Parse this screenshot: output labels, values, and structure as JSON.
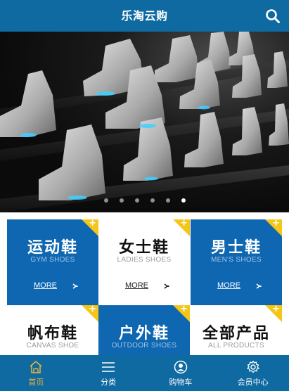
{
  "header": {
    "title": "乐淘云购"
  },
  "banner": {
    "slides": 6,
    "active_slide": 6
  },
  "categories": [
    {
      "cn": "运动鞋",
      "en": "GYM SHOES",
      "more": "MORE",
      "style": "blue"
    },
    {
      "cn": "女士鞋",
      "en": "LADIES SHOES",
      "more": "MORE",
      "style": "white"
    },
    {
      "cn": "男士鞋",
      "en": "MEN'S SHOES",
      "more": "MORE",
      "style": "blue"
    },
    {
      "cn": "帆布鞋",
      "en": "CANVAS SHOE",
      "more": "",
      "style": "white"
    },
    {
      "cn": "户外鞋",
      "en": "OUTDOOR SHOES",
      "more": "",
      "style": "blue"
    },
    {
      "cn": "全部产品",
      "en": "ALL PRODUCTS",
      "more": "",
      "style": "white"
    }
  ],
  "nav": [
    {
      "label": "首页",
      "icon": "home-icon",
      "active": true
    },
    {
      "label": "分类",
      "icon": "menu-icon",
      "active": false
    },
    {
      "label": "购物车",
      "icon": "user-circle-icon",
      "active": false
    },
    {
      "label": "会员中心",
      "icon": "gear-icon",
      "active": false
    }
  ],
  "colors": {
    "primary": "#0e6aa1",
    "tile_blue": "#0f67b1",
    "accent": "#f5c518",
    "nav_active": "#f0b33b"
  }
}
